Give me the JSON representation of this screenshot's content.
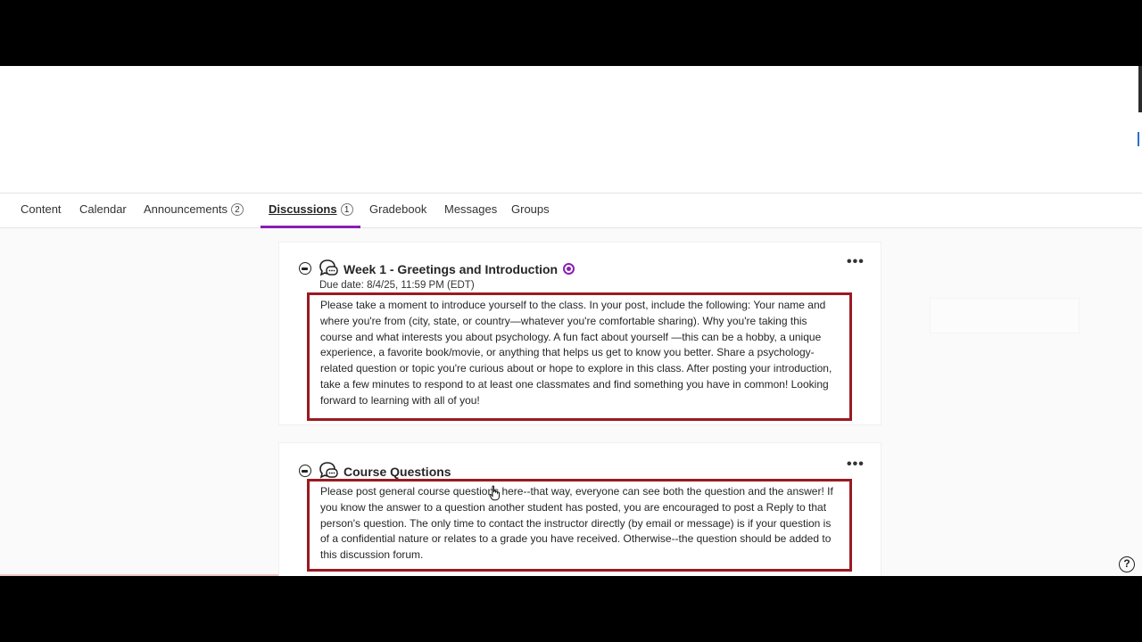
{
  "tabs": [
    {
      "label": "Content"
    },
    {
      "label": "Calendar"
    },
    {
      "label": "Announcements",
      "count": "2"
    },
    {
      "label": "Discussions",
      "count": "1",
      "active": true
    },
    {
      "label": "Gradebook"
    },
    {
      "label": "Messages"
    },
    {
      "label": "Groups"
    }
  ],
  "discussions": [
    {
      "title": "Week 1 - Greetings and Introduction",
      "due_date": "Due date: 8/4/25, 11:59 PM (EDT)",
      "description": "Please take a moment to introduce yourself to the class. In your post, include the following: Your name and where you're from (city, state, or country—whatever you're comfortable sharing). Why you're taking this course and what interests you about psychology. A fun fact about yourself —this can be a hobby, a unique experience, a favorite book/movie, or anything that helps us get to know you better. Share a psychology-related question or topic you're curious about or hope to explore in this class. After posting your introduction, take a few minutes to respond to at least one classmates and find something you have in common! Looking forward to learning with all of you!"
    },
    {
      "title": "Course Questions",
      "description": "Please post general course questions here--that way, everyone can see both the question and the answer! If you know the answer to a question another student has posted, you are encouraged to post a Reply to that person's question. The only time to contact the instructor directly (by email or message) is if your question is of a confidential nature or relates to a grade you have received. Otherwise--the question should be added to this discussion forum."
    }
  ],
  "more_label": "•••",
  "help_label": "?",
  "icons": {
    "collapse": "collapse-circle-icon",
    "discussion": "discussion-bubble-icon",
    "moderated": "moderated-icon",
    "more": "more-options-icon",
    "help": "help-icon"
  },
  "colors": {
    "accent": "#8a1fb3",
    "highlight_border": "#9a1a21"
  }
}
